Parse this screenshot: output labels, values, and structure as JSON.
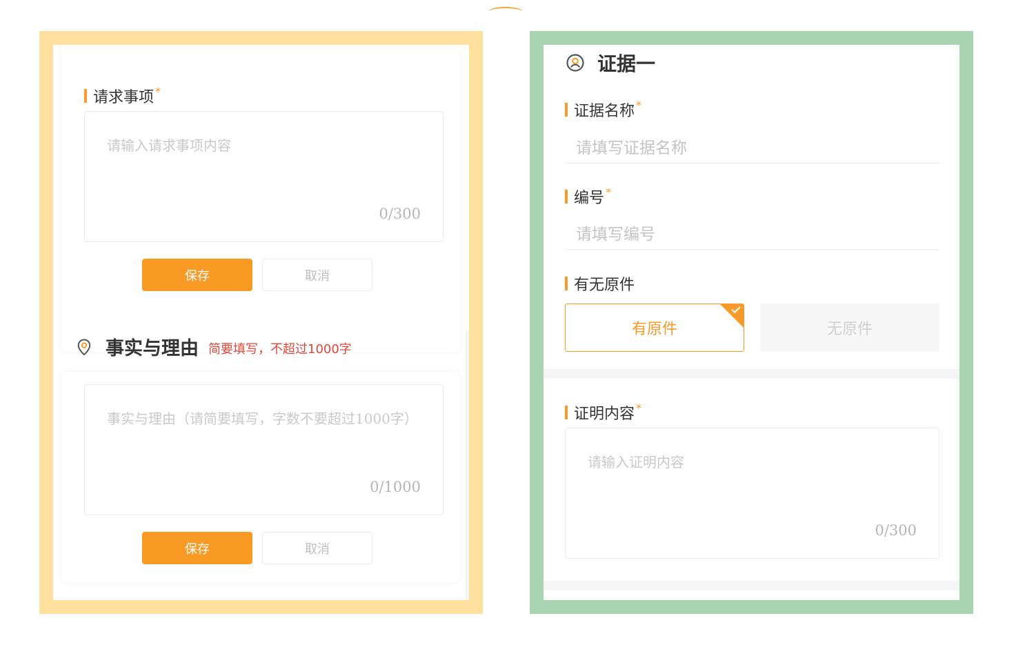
{
  "left_panel": {
    "request": {
      "label": "请求事项",
      "required_mark": "*",
      "placeholder": "请输入请求事项内容",
      "counter": "0/300",
      "save_label": "保存",
      "cancel_label": "取消"
    },
    "facts": {
      "section_title": "事实与理由",
      "section_hint": "简要填写，不超过1000字",
      "placeholder": "事实与理由（请简要填写，字数不要超过1000字）",
      "counter": "0/1000",
      "save_label": "保存",
      "cancel_label": "取消"
    }
  },
  "right_panel": {
    "title": "证据一",
    "name_field": {
      "label": "证据名称",
      "required_mark": "*",
      "placeholder": "请填写证据名称"
    },
    "number_field": {
      "label": "编号",
      "required_mark": "*",
      "placeholder": "请填写编号"
    },
    "original_field": {
      "label": "有无原件",
      "options": [
        "有原件",
        "无原件"
      ],
      "selected": "有原件"
    },
    "proof_field": {
      "label": "证明内容",
      "required_mark": "*",
      "placeholder": "请输入证明内容",
      "counter": "0/300"
    }
  },
  "colors": {
    "accent": "#f79a2a",
    "hint_red": "#e0483a",
    "frame_left": "#ffe19f",
    "frame_right": "#a8d4b1"
  },
  "icons": {
    "facts_section": "location-pin-icon",
    "evidence_section": "user-circle-icon",
    "selected_option": "check-icon"
  }
}
